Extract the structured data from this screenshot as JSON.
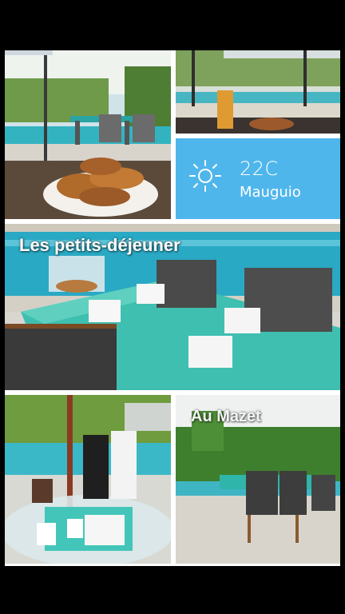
{
  "weather": {
    "temperature": "22C",
    "city": "Mauguio",
    "icon": "sun-icon",
    "accent": "#4fb6ec"
  },
  "captions": {
    "breakfast": "Les petits-déjeuner",
    "place": "Au Mazet"
  },
  "photos": [
    {
      "name": "croissants-photo",
      "description": "croissants on a plate, pool in background"
    },
    {
      "name": "table-umbrella-photo",
      "description": "juice and pastries on outdoor table"
    },
    {
      "name": "breakfast-table-photo",
      "description": "breakfast table set by the pool"
    },
    {
      "name": "tray-photo",
      "description": "breakfast tray with thermos and jams"
    },
    {
      "name": "garden-photo",
      "description": "garden table and chairs by pool"
    }
  ]
}
